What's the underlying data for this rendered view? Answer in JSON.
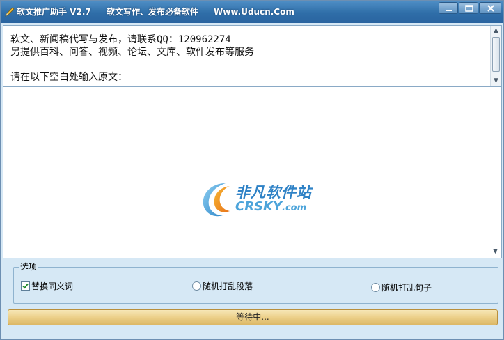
{
  "titlebar": {
    "app_name": "软文推广助手 V2.7",
    "slogan": "软文写作、发布必备软件",
    "website": "Www.Uducn.Com",
    "icon": "pen-icon"
  },
  "window_controls": {
    "minimize_icon": "minimize-icon",
    "maximize_icon": "maximize-icon",
    "close_icon": "close-icon"
  },
  "info": {
    "line1": "软文、新闻稿代写与发布，请联系QQ：120962274",
    "line2": "另提供百科、问答、视频、论坛、文库、软件发布等服务",
    "line3": "请在以下空白处输入原文："
  },
  "editor": {
    "content": ""
  },
  "watermark": {
    "cn_text": "非凡软件站",
    "en_text": "CRSKY",
    "en_suffix": ".com"
  },
  "options": {
    "group_label": "选项",
    "replace_synonyms": {
      "label": "替换同义词",
      "checked": true
    },
    "shuffle_paragraphs": {
      "label": "随机打乱段落",
      "checked": false
    },
    "shuffle_sentences": {
      "label": "随机打乱句子",
      "checked": false
    }
  },
  "status": {
    "text": "等待中...",
    "progress": 1.0
  },
  "colors": {
    "titlebar": "#2f6ea8",
    "window_bg": "#d6e8f5",
    "progress": "#ecd08a",
    "watermark_blue": "#2f82c6"
  }
}
